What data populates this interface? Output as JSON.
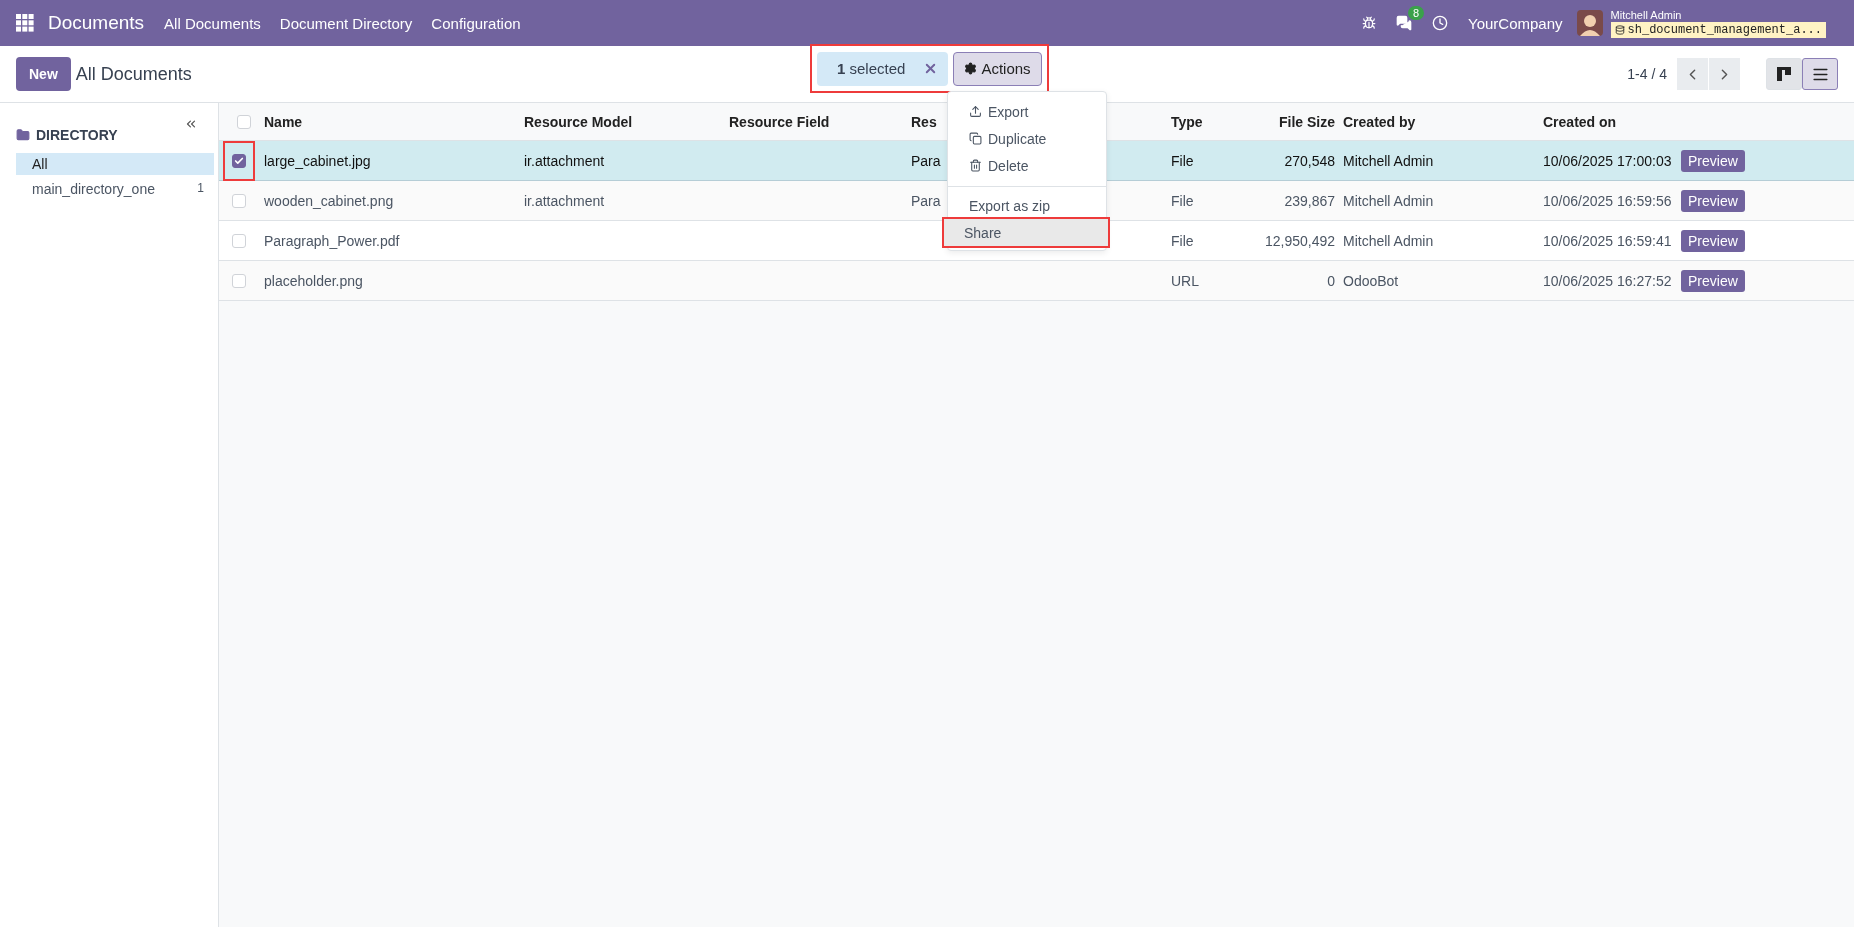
{
  "navbar": {
    "app_title": "Documents",
    "menu": [
      "All Documents",
      "Document Directory",
      "Configuration"
    ],
    "messages_badge": "8",
    "company": "YourCompany",
    "user": "Mitchell Admin",
    "database": "sh_document_management_a..."
  },
  "control_panel": {
    "new_button": "New",
    "breadcrumb": "All Documents",
    "selection": {
      "count": "1",
      "label": "selected",
      "highlighted": true
    },
    "actions_button": "Actions",
    "pager": "1-4 / 4",
    "views": [
      {
        "kind": "kanban",
        "selected": false
      },
      {
        "kind": "list",
        "selected": true
      }
    ]
  },
  "actions_menu": {
    "groups": [
      [
        {
          "kind": "export",
          "label": "Export",
          "highlighted": false
        },
        {
          "kind": "duplicate",
          "label": "Duplicate",
          "highlighted": false
        },
        {
          "kind": "delete",
          "label": "Delete",
          "highlighted": false
        }
      ],
      [
        {
          "kind": "plain",
          "label": "Export as zip",
          "highlighted": false
        },
        {
          "kind": "plain",
          "label": "Share",
          "highlighted": true
        }
      ]
    ]
  },
  "sidebar": {
    "title": "DIRECTORY",
    "items": [
      {
        "label": "All",
        "selected": true
      },
      {
        "label": "main_directory_one",
        "count": "1",
        "selected": false
      }
    ]
  },
  "table": {
    "select_all_checked": false,
    "columns": [
      "Name",
      "Resource Model",
      "Resource Field",
      "Res",
      "Type",
      "File Size",
      "Created by",
      "Created on"
    ],
    "rows": [
      {
        "checked": true,
        "highlighted": true,
        "cells": [
          "large_cabinet.jpg",
          "ir.attachment",
          "",
          "Para",
          "File",
          "270,548",
          "Mitchell Admin",
          "10/06/2025 17:00:03"
        ],
        "preview": "Preview"
      },
      {
        "checked": false,
        "highlighted": false,
        "cells": [
          "wooden_cabinet.png",
          "ir.attachment",
          "",
          "Para",
          "File",
          "239,867",
          "Mitchell Admin",
          "10/06/2025 16:59:56"
        ],
        "preview": "Preview"
      },
      {
        "checked": false,
        "highlighted": false,
        "cells": [
          "Paragraph_Power.pdf",
          "",
          "",
          "",
          "File",
          "12,950,492",
          "Mitchell Admin",
          "10/06/2025 16:59:41"
        ],
        "preview": "Preview"
      },
      {
        "checked": false,
        "highlighted": false,
        "cells": [
          "placeholder.png",
          "",
          "",
          "",
          "URL",
          "0",
          "OdooBot",
          "10/06/2025 16:27:52"
        ],
        "preview": "Preview"
      }
    ]
  }
}
